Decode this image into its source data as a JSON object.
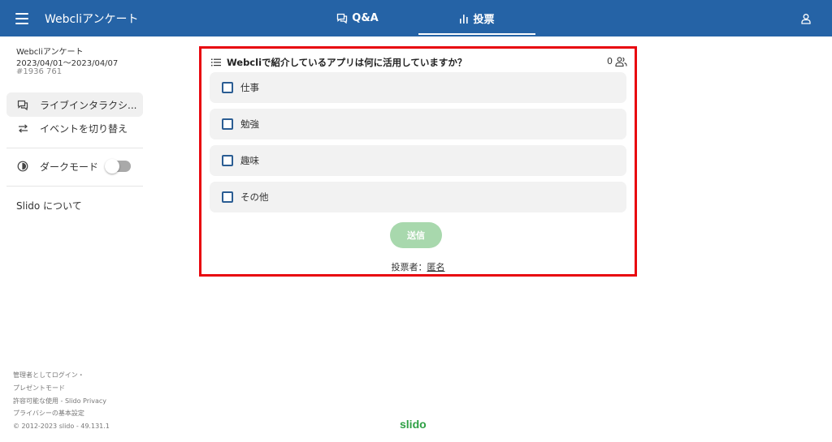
{
  "header": {
    "app_title": "Webcliアンケート",
    "tabs": [
      {
        "label": "Q&A",
        "icon": "chat-bubbles-icon"
      },
      {
        "label": "投票",
        "icon": "bar-chart-icon",
        "active": true
      }
    ],
    "accent": "#2563a6"
  },
  "sidebar": {
    "event_name": "Webcliアンケート",
    "event_dates": "2023/04/01～2023/04/07",
    "event_code": "#1936 761",
    "items": [
      {
        "label": "ライブインタラクシ...",
        "icon": "chat-bubbles-icon",
        "active": true
      },
      {
        "label": "イベントを切り替え",
        "icon": "switch-arrows-icon"
      }
    ],
    "dark_mode_label": "ダークモード",
    "dark_mode_on": false,
    "about_label": "Slido について",
    "footer": [
      "管理者としてログイン・",
      "プレゼントモード",
      "許容可能な使用 - Slido Privacy",
      "プライバシーの基本設定",
      "© 2012-2023 slido - 49.131.1"
    ]
  },
  "poll": {
    "question": "Webcliで紹介しているアプリは何に活用していますか？",
    "participant_count": "0",
    "options": [
      "仕事",
      "勉強",
      "趣味",
      "その他"
    ],
    "submit_label": "送信",
    "voter_prefix": "投票者：",
    "voter_link": "匿名",
    "highlight_color": "#e8060f",
    "submit_color": "#a8d8ad"
  },
  "brand": "slido"
}
